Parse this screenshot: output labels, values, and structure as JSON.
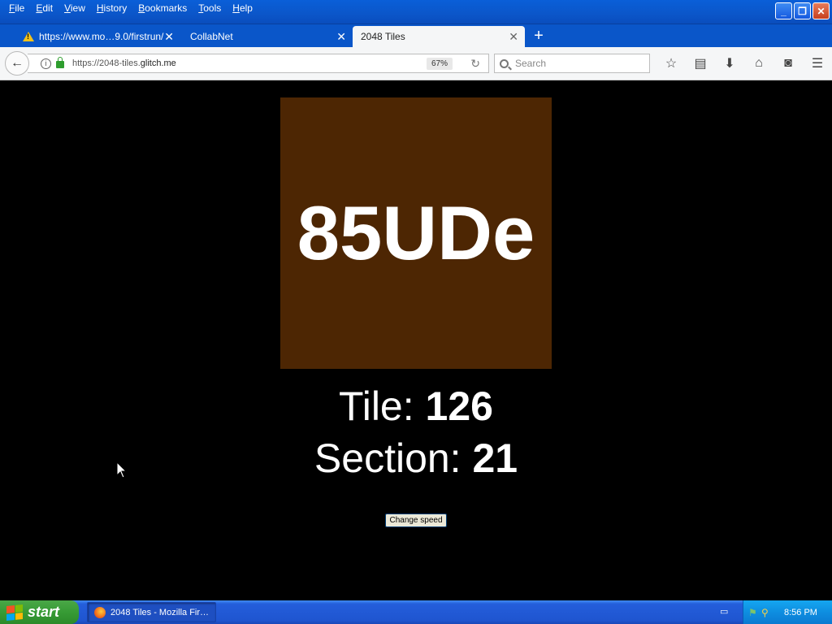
{
  "menubar": {
    "items": [
      {
        "label": "File",
        "mnemonic": "F"
      },
      {
        "label": "Edit",
        "mnemonic": "E"
      },
      {
        "label": "View",
        "mnemonic": "V"
      },
      {
        "label": "History",
        "mnemonic": "H"
      },
      {
        "label": "Bookmarks",
        "mnemonic": "B"
      },
      {
        "label": "Tools",
        "mnemonic": "T"
      },
      {
        "label": "Help",
        "mnemonic": "H"
      }
    ]
  },
  "window_controls": {
    "minimize": "_",
    "restore": "❐",
    "close": "✕"
  },
  "tabs": [
    {
      "label": "https://www.mo…9.0/firstrun/",
      "icon": "warning-icon",
      "active": false
    },
    {
      "label": "CollabNet",
      "active": false
    },
    {
      "label": "2048 Tiles",
      "active": true
    }
  ],
  "new_tab_symbol": "+",
  "navbar": {
    "url_prefix": "https://2048-tiles.",
    "url_domain": "glitch.me",
    "zoom": "67%",
    "search_placeholder": "Search"
  },
  "page": {
    "tile_label": "85UDe",
    "tile_color": "#4d2603",
    "tile_line_label": "Tile: ",
    "tile_value": "126",
    "section_line_label": "Section: ",
    "section_value": "21",
    "change_speed_button": "Change speed"
  },
  "taskbar": {
    "start_label": "start",
    "task_item_label": "2048 Tiles - Mozilla Fir…",
    "clock": "8:56 PM"
  }
}
